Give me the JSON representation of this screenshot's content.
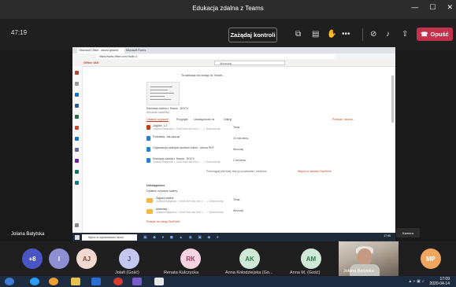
{
  "window": {
    "title": "Edukacja zdalna z Teams"
  },
  "controls": {
    "timer": "47:19",
    "request_control": "Zażądaj kontroli",
    "more": "•••",
    "leave": "Opuść"
  },
  "shared_screen": {
    "tab_active": "Microsoft Office - strona główna",
    "tab_second": "Microsoft Forms",
    "url": "https://www.office.com/?auth=2",
    "office_brand": "Office 365",
    "search_placeholder": "Wyszukaj",
    "doc_title_1": "Ta aplikacja ma dostęp do Twoich...",
    "doc_caption_1": "Edukacja zdalna z Teams - DOCX",
    "doc_caption_2": "Aktualne materiały",
    "tabs": [
      "Ostatnie używane",
      "Przypięte",
      "Udostępnione mi",
      "Odkryj"
    ],
    "upload": "Przekaż i otwórz...",
    "files": [
      {
        "name": "Zajęcia: 1-3",
        "meta": "Jolanta Batytska > OneDrive dla firm > ... > Dokumenty",
        "date": "Teraz",
        "color": "#c43e1c"
      },
      {
        "name": "Podstawy: Jak zacząć",
        "meta": "",
        "date": "10 min temu",
        "color": "#2b7cd3"
      },
      {
        "name": "Organizacja zdalnych spotkań online - strona PDF",
        "meta": "",
        "date": "Wczoraj",
        "color": "#2b7cd3"
      },
      {
        "name": "Edukacja zdalna z Teams - DOCX",
        "meta": "Jolanta Batytska > OneDrive dla firm > ... > Dokumenty",
        "date": "2 dni temu",
        "color": "#2b7cd3"
      }
    ],
    "more_files_link": "Więcej w usłudze OneDrive",
    "drag_hint": "Przeciągnij plik tutaj, aby go przekazać i otworzyć",
    "shared_heading": "Udostępnione",
    "shared_sub": "Ostatnio używane foldery",
    "folders": [
      {
        "name": "Zajęcia zdalne",
        "meta": "Jolanta Batytska > OneDrive dla firm > ... > Dokumenty",
        "date": "Teraz"
      },
      {
        "name": "Materiały",
        "meta": "Jolanta Batytska > OneDrive dla firm > ... > Dokumenty",
        "date": "Wczoraj"
      }
    ],
    "go_onedrive": "Przejdź do usługi OneDrive",
    "inner_search": "Wpisz tu wyszukiwane słowo",
    "inner_time": "17:06"
  },
  "presenter": {
    "name": "Jolana Batytska"
  },
  "participants": [
    {
      "initials": "+8",
      "name": "",
      "color": "#4a55c4",
      "text": "#ffffff"
    },
    {
      "initials": "I",
      "name": "",
      "color": "#8c8fd1",
      "text": "#ffffff"
    },
    {
      "initials": "AJ",
      "name": "",
      "color": "#f1d9cf",
      "text": "#7a4b3a"
    },
    {
      "initials": "J",
      "name": "Jolafi (Gość)",
      "color": "#c3c7ef",
      "text": "#4b4e8f"
    },
    {
      "initials": "RK",
      "name": "Renata Kulczycka",
      "color": "#f6d3e0",
      "text": "#a23a66"
    },
    {
      "initials": "AK",
      "name": "Anna Kołodziejska (Go...",
      "color": "#cfe9d6",
      "text": "#2f7a45"
    },
    {
      "initials": "AM",
      "name": "Anna M. (Gość)",
      "color": "#cfe9d6",
      "text": "#2f7a45"
    },
    {
      "initials": "MP",
      "name": "",
      "color": "#f0a55e",
      "text": "#ffffff"
    }
  ],
  "video_tile": {
    "name": "Jolana Batytska",
    "camera_label": "Kamera"
  },
  "taskbar": {
    "time": "17:09",
    "date": "2020-04-14"
  }
}
